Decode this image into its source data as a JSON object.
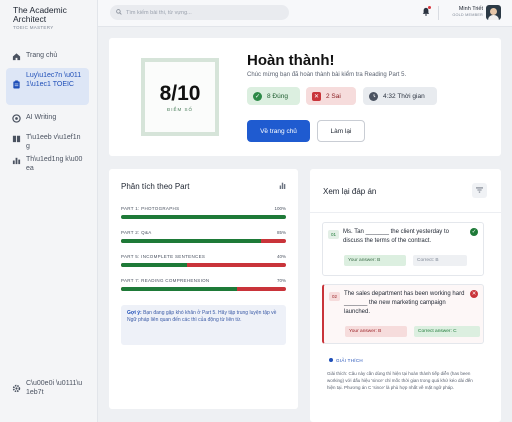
{
  "brand": {
    "title": "The Academic Architect",
    "subtitle": "TOEIC MASTERY"
  },
  "sidebar": {
    "items": [
      {
        "label": "Trang chủ",
        "icon": "home-icon",
        "active": false
      },
      {
        "label": "Luy\\u1ec7n \\u0111\\u1ec1 TOEIC",
        "icon": "clipboard-icon",
        "active": true
      },
      {
        "label": "AI Writing",
        "icon": "ai-writing-icon",
        "active": false
      },
      {
        "label": "T\\u1eeb v\\u1ef1ng",
        "icon": "book-icon",
        "active": false
      },
      {
        "label": "Th\\u1ed1ng k\\u00ea",
        "icon": "chart-icon",
        "active": false
      }
    ],
    "footer": {
      "label": "C\\u00e0i \\u0111\\u1eb7t",
      "icon": "gear-icon"
    }
  },
  "topbar": {
    "search_placeholder": "Tìm kiếm bài thi, từ vựng...",
    "user_name": "Minh Triết",
    "user_role": "GOLD MEMBER"
  },
  "result": {
    "score": "8/10",
    "score_label": "ĐIỂM SỐ",
    "title": "Hoàn thành!",
    "subtitle": "Chúc mừng bạn đã hoàn thành bài kiểm tra Reading Part 5.",
    "correct_label": "8 Đúng",
    "wrong_label": "2 Sai",
    "time_label": "4:32 Thời gian",
    "home_button": "Về trang chủ",
    "retry_button": "Làm lại"
  },
  "analysis": {
    "title": "Phân tích theo Part",
    "parts": [
      {
        "label": "PART 1: PHOTOGRAPHS",
        "pct_text": "100%",
        "value": 100
      },
      {
        "label": "PART 2: Q&A",
        "pct_text": "85%",
        "value": 85
      },
      {
        "label": "PART 5: INCOMPLETE SENTENCES",
        "pct_text": "40%",
        "value": 40
      },
      {
        "label": "PART 7: READING COMPREHENSION",
        "pct_text": "70%",
        "value": 70
      }
    ],
    "tip_label": "Gợi ý:",
    "tip_text": "Bạn đang gặp khó khăn ở Part 5. Hãy tập trung luyện tập về Ngữ pháp liên quan đến các thì của động từ liên từ."
  },
  "review": {
    "title": "Xem lại đáp án",
    "questions": [
      {
        "num": "01",
        "text": "Ms. Tan _______ the client yesterday to discuss the terms of the contract.",
        "your_answer": "Your answer: B",
        "correct_answer": "Correct: B",
        "status": "correct"
      },
      {
        "num": "02",
        "text": "The sales department has been working hard _______ the new marketing campaign launched.",
        "your_answer": "Your answer: B",
        "correct_answer": "Correct answer: C",
        "status": "wrong",
        "explain_head": "GIẢI THÍCH",
        "explain_text": "Giải thích: Câu này cần dùng thì hiện tại hoàn thành tiếp diễn (has been working) với dấu hiệu 'since' chỉ mốc thời gian trong quá khứ kéo dài đến hiện tại. Phương án C 'since' là phù hợp nhất về mặt ngữ pháp."
      }
    ]
  },
  "colors": {
    "accent": "#1f5bd0",
    "correct": "#1e7a38",
    "wrong": "#c9343a"
  }
}
